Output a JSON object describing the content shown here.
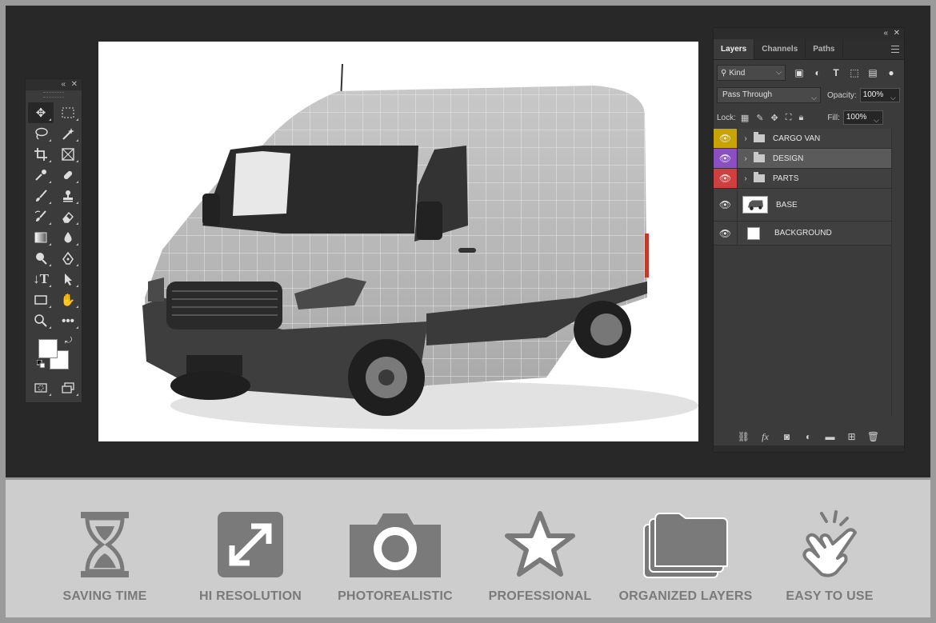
{
  "tools_panel": {
    "collapse_icon": "double-chevron-left-icon",
    "close_icon": "close-icon",
    "tools": [
      {
        "name": "move-tool",
        "icon": "move-icon",
        "active": true
      },
      {
        "name": "marquee-tool",
        "icon": "rect-marquee-icon"
      },
      {
        "name": "lasso-tool",
        "icon": "lasso-icon"
      },
      {
        "name": "magic-wand-tool",
        "icon": "magic-wand-icon"
      },
      {
        "name": "crop-tool",
        "icon": "crop-icon"
      },
      {
        "name": "frame-tool",
        "icon": "frame-icon"
      },
      {
        "name": "eyedropper-tool",
        "icon": "eyedropper-icon"
      },
      {
        "name": "healing-tool",
        "icon": "bandage-icon"
      },
      {
        "name": "brush-tool",
        "icon": "brush-icon"
      },
      {
        "name": "stamp-tool",
        "icon": "stamp-icon"
      },
      {
        "name": "history-brush-tool",
        "icon": "history-brush-icon"
      },
      {
        "name": "eraser-tool",
        "icon": "eraser-icon"
      },
      {
        "name": "gradient-tool",
        "icon": "gradient-icon"
      },
      {
        "name": "blur-tool",
        "icon": "drop-icon"
      },
      {
        "name": "dodge-tool",
        "icon": "dodge-icon"
      },
      {
        "name": "pen-tool",
        "icon": "pen-icon"
      },
      {
        "name": "type-tool",
        "icon": "type-icon"
      },
      {
        "name": "path-select-tool",
        "icon": "arrow-icon"
      },
      {
        "name": "shape-tool",
        "icon": "rectangle-icon"
      },
      {
        "name": "hand-tool",
        "icon": "hand-icon"
      },
      {
        "name": "zoom-tool",
        "icon": "zoom-icon"
      },
      {
        "name": "more-tools",
        "icon": "ellipsis-icon"
      }
    ],
    "foreground_color": "#ffffff",
    "background_color": "#ffffff"
  },
  "layers_panel": {
    "tabs": [
      {
        "label": "Layers",
        "active": true
      },
      {
        "label": "Channels",
        "active": false
      },
      {
        "label": "Paths",
        "active": false
      }
    ],
    "filter_kind": "Kind",
    "blend_mode": "Pass Through",
    "opacity_label": "Opacity:",
    "opacity_value": "100%",
    "lock_label": "Lock:",
    "fill_label": "Fill:",
    "fill_value": "100%",
    "layers": [
      {
        "name": "CARGO VAN",
        "type": "group",
        "color": "#c9a400",
        "selected": false
      },
      {
        "name": "DESIGN",
        "type": "group",
        "color": "#8a4fc0",
        "selected": true
      },
      {
        "name": "PARTS",
        "type": "group",
        "color": "#cf3f3f",
        "selected": false
      },
      {
        "name": "BASE",
        "type": "image",
        "color": null,
        "selected": false
      },
      {
        "name": "BACKGROUND",
        "type": "fill",
        "color": null,
        "selected": false
      }
    ]
  },
  "features": [
    {
      "label": "SAVING TIME",
      "icon": "hourglass-icon"
    },
    {
      "label": "HI RESOLUTION",
      "icon": "expand-icon"
    },
    {
      "label": "PHOTOREALISTIC",
      "icon": "camera-icon"
    },
    {
      "label": "PROFESSIONAL",
      "icon": "star-icon"
    },
    {
      "label": "ORGANIZED LAYERS",
      "icon": "stacked-folders-icon"
    },
    {
      "label": "EASY TO USE",
      "icon": "tap-hand-icon"
    }
  ],
  "colors": {
    "workspace": "#282828",
    "panel": "#3b3b3b",
    "feature_bar": "#cdcdcd",
    "feature_icon": "#7a7a7a"
  }
}
